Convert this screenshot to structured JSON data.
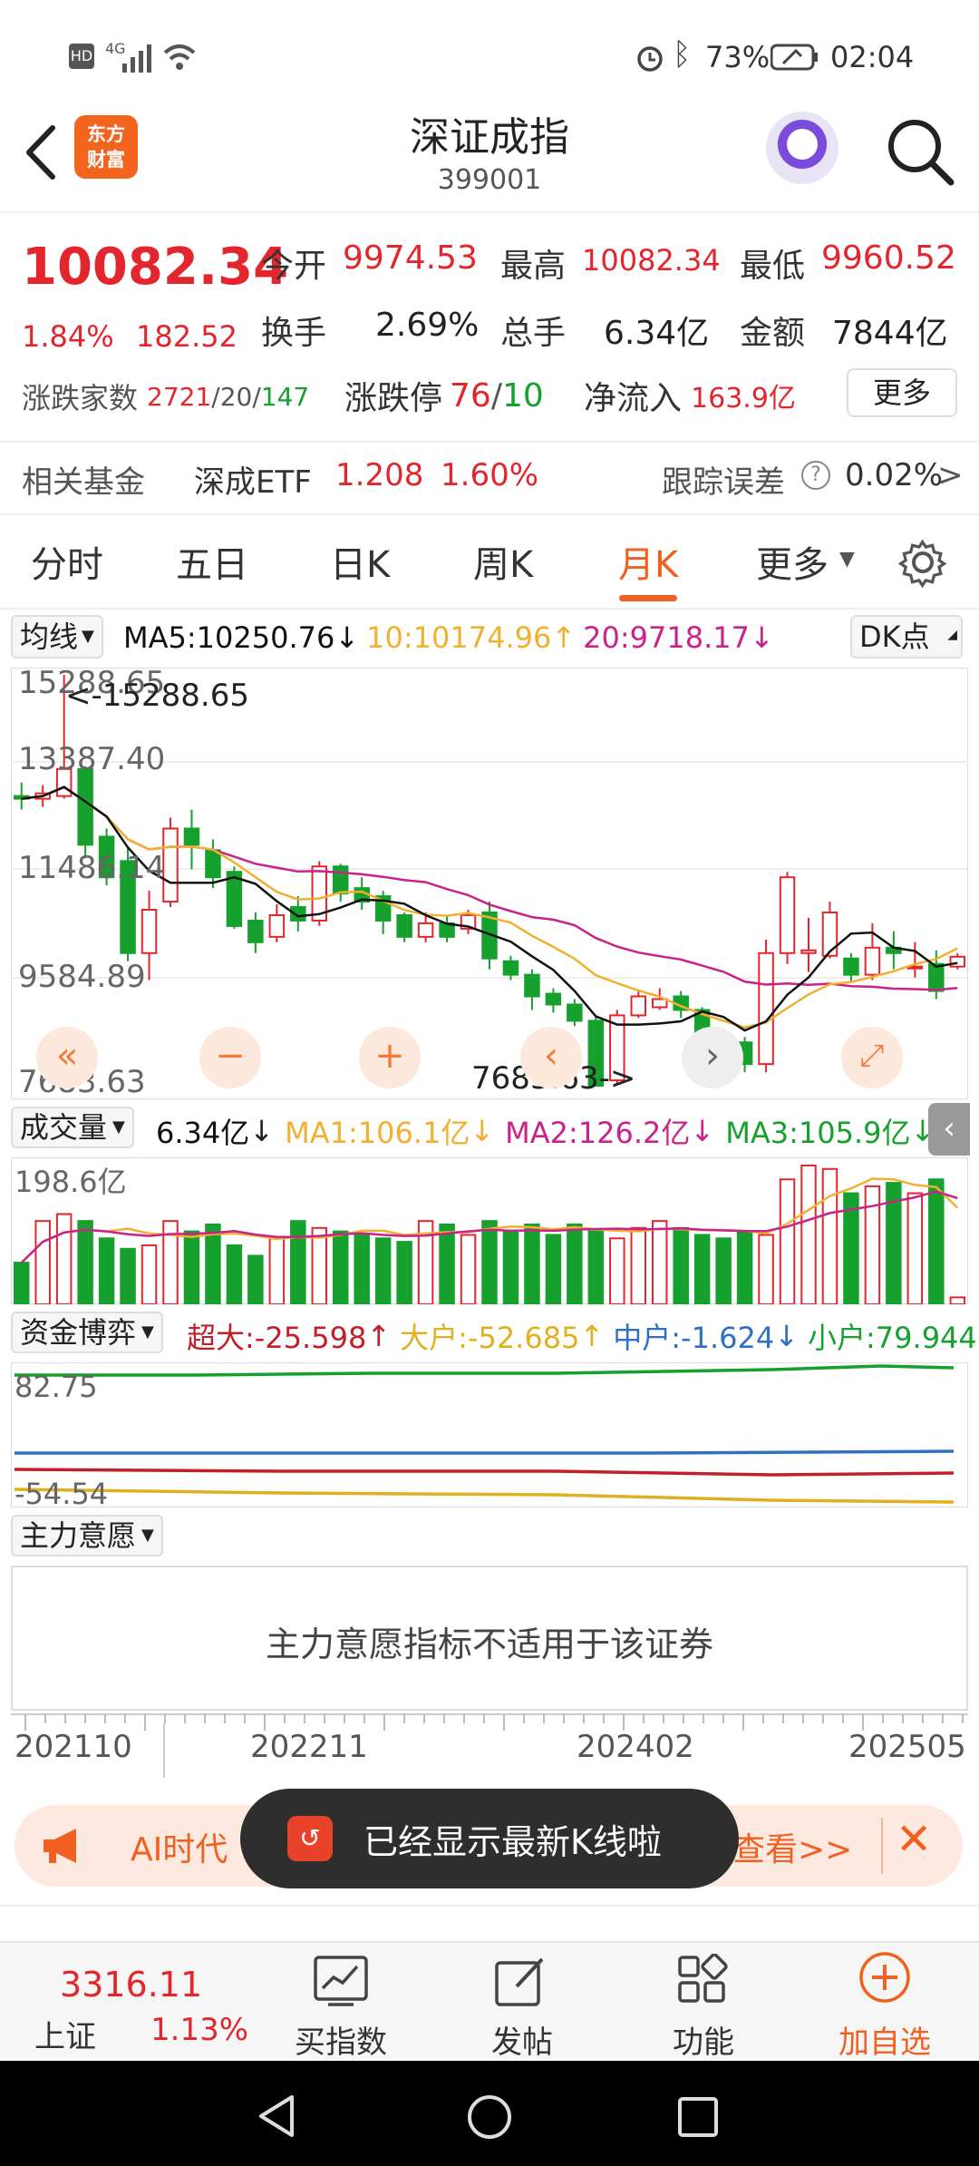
{
  "status_bar": {
    "left_icons": [
      "hd-icon",
      "signal-icon",
      "wifi-icon"
    ],
    "network_label": "4G",
    "battery": "73%",
    "time": "02:04"
  },
  "header": {
    "logo_line1": "东方",
    "logo_line2": "财富",
    "title": "深证成指",
    "code": "399001"
  },
  "quote": {
    "price": "10082.34",
    "change_pct": "1.84%",
    "change_abs": "182.52",
    "open_label": "今开",
    "open": "9974.53",
    "high_label": "最高",
    "high": "10082.34",
    "low_label": "最低",
    "low": "9960.52",
    "turnover_label": "换手",
    "turnover": "2.69%",
    "volume_label": "总手",
    "volume": "6.34亿",
    "amount_label": "金额",
    "amount": "7844亿",
    "updown_label": "涨跌家数",
    "up_count": "2721",
    "flat_count": "20",
    "down_count": "147",
    "limit_label": "涨跌停",
    "limit_up": "76",
    "limit_down": "10",
    "netflow_label": "净流入",
    "netflow": "163.9亿",
    "more_label": "更多"
  },
  "fund": {
    "label": "相关基金",
    "name": "深成ETF",
    "price": "1.208",
    "pct": "1.60%",
    "tracking_label": "跟踪误差",
    "tracking_value": "0.02%",
    "arrow": ">"
  },
  "tabs": [
    {
      "label": "分时"
    },
    {
      "label": "五日"
    },
    {
      "label": "日K"
    },
    {
      "label": "周K"
    },
    {
      "label": "月K"
    },
    {
      "label": "更多"
    }
  ],
  "active_tab": "月K",
  "ma": {
    "selector": "均线",
    "ma5": "MA5:10250.76",
    "ma10": "10:10174.96",
    "ma20": "20:9718.17",
    "dk_label": "DK点"
  },
  "price_axis": [
    "15288.65",
    "13387.40",
    "11486.14",
    "9584.89",
    "7683.63"
  ],
  "price_annotations": {
    "high": "<-15288.65",
    "low": "7683.63->"
  },
  "volume_row": {
    "selector": "成交量",
    "vol": "6.34亿",
    "ma1": "MA1:106.1亿",
    "ma2": "MA2:126.2亿",
    "ma3": "MA3:105.9亿",
    "axis_top": "198.6亿"
  },
  "fund_flow": {
    "selector": "资金博弈",
    "super": "超大:-25.598",
    "large": "大户:-52.685",
    "mid": "中户:-1.624",
    "small": "小户:79.944",
    "axis_top": "82.75",
    "axis_bottom": "-54.54"
  },
  "intent": {
    "selector": "主力意愿",
    "message": "主力意愿指标不适用于该证券"
  },
  "time_axis": [
    "202110",
    "202211",
    "202402",
    "202505"
  ],
  "banner": {
    "text": "AI时代",
    "link": "查看>>"
  },
  "toast": "已经显示最新K线啦",
  "bottom_bar": {
    "index_price": "3316.11",
    "index_name": "上证",
    "index_pct": "1.13%",
    "items": [
      "买指数",
      "发帖",
      "功能",
      "加自选"
    ]
  },
  "colors": {
    "up": "#e3262d",
    "down": "#16a02e",
    "accent": "#f06121",
    "ma5": "#111111",
    "ma10": "#f0b030",
    "ma20": "#c9228b"
  },
  "chart_data": {
    "type": "candlestick",
    "period": "monthly",
    "candles": [
      {
        "o": 13050,
        "c": 13000,
        "h": 13300,
        "l": 12800
      },
      {
        "o": 13000,
        "c": 13100,
        "h": 13250,
        "l": 12850
      },
      {
        "o": 13050,
        "c": 13550,
        "h": 15288.65,
        "l": 13000
      },
      {
        "o": 13550,
        "c": 12150,
        "h": 13600,
        "l": 11900
      },
      {
        "o": 12300,
        "c": 11550,
        "h": 12450,
        "l": 11400
      },
      {
        "o": 11850,
        "c": 10150,
        "h": 12100,
        "l": 10000
      },
      {
        "o": 10150,
        "c": 10950,
        "h": 11300,
        "l": 9650
      },
      {
        "o": 11100,
        "c": 12450,
        "h": 12650,
        "l": 11000
      },
      {
        "o": 12450,
        "c": 12150,
        "h": 12800,
        "l": 11700
      },
      {
        "o": 12050,
        "c": 11550,
        "h": 12250,
        "l": 11350
      },
      {
        "o": 11650,
        "c": 10650,
        "h": 11750,
        "l": 10600
      },
      {
        "o": 10750,
        "c": 10350,
        "h": 10900,
        "l": 10150
      },
      {
        "o": 10450,
        "c": 10850,
        "h": 11050,
        "l": 10350
      },
      {
        "o": 11000,
        "c": 10750,
        "h": 11200,
        "l": 10550
      },
      {
        "o": 10750,
        "c": 11750,
        "h": 11850,
        "l": 10650
      },
      {
        "o": 11750,
        "c": 11250,
        "h": 11800,
        "l": 11100
      },
      {
        "o": 11350,
        "c": 11100,
        "h": 11550,
        "l": 10950
      },
      {
        "o": 11200,
        "c": 10750,
        "h": 11300,
        "l": 10500
      },
      {
        "o": 10850,
        "c": 10450,
        "h": 10900,
        "l": 10350
      },
      {
        "o": 10450,
        "c": 10700,
        "h": 10900,
        "l": 10350
      },
      {
        "o": 10700,
        "c": 10450,
        "h": 10850,
        "l": 10350
      },
      {
        "o": 10600,
        "c": 10850,
        "h": 10950,
        "l": 10500
      },
      {
        "o": 10900,
        "c": 10050,
        "h": 11100,
        "l": 9850
      },
      {
        "o": 10000,
        "c": 9750,
        "h": 10100,
        "l": 9650
      },
      {
        "o": 9750,
        "c": 9350,
        "h": 9850,
        "l": 9100
      },
      {
        "o": 9400,
        "c": 9200,
        "h": 9500,
        "l": 9050
      },
      {
        "o": 9200,
        "c": 8900,
        "h": 9300,
        "l": 8800
      },
      {
        "o": 8900,
        "c": 7700,
        "h": 9000,
        "l": 7683.63
      },
      {
        "o": 7800,
        "c": 9000,
        "h": 9100,
        "l": 7750
      },
      {
        "o": 9000,
        "c": 9350,
        "h": 9450,
        "l": 8950
      },
      {
        "o": 9150,
        "c": 9300,
        "h": 9500,
        "l": 9100
      },
      {
        "o": 9350,
        "c": 9100,
        "h": 9450,
        "l": 8950
      },
      {
        "o": 9100,
        "c": 8600,
        "h": 9150,
        "l": 8500
      },
      {
        "o": 8650,
        "c": 8500,
        "h": 8750,
        "l": 8350
      },
      {
        "o": 8500,
        "c": 8100,
        "h": 8600,
        "l": 7950
      },
      {
        "o": 8100,
        "c": 10150,
        "h": 10400,
        "l": 7950
      },
      {
        "o": 10150,
        "c": 11550,
        "h": 11650,
        "l": 9950
      },
      {
        "o": 10150,
        "c": 10200,
        "h": 10800,
        "l": 9800
      },
      {
        "o": 10100,
        "c": 10900,
        "h": 11100,
        "l": 10050
      },
      {
        "o": 10050,
        "c": 9750,
        "h": 10150,
        "l": 9600
      },
      {
        "o": 9750,
        "c": 10250,
        "h": 10700,
        "l": 9650
      },
      {
        "o": 10250,
        "c": 10150,
        "h": 10550,
        "l": 9850
      },
      {
        "o": 9900,
        "c": 9900,
        "h": 10350,
        "l": 9700
      },
      {
        "o": 9950,
        "c": 9450,
        "h": 10200,
        "l": 9300
      },
      {
        "o": 9900,
        "c": 10082.34,
        "h": 10150,
        "l": 9850
      }
    ],
    "volume": [
      60,
      120,
      130,
      120,
      95,
      80,
      85,
      120,
      105,
      115,
      85,
      70,
      95,
      120,
      110,
      105,
      100,
      95,
      90,
      120,
      115,
      100,
      120,
      105,
      115,
      100,
      115,
      105,
      95,
      110,
      120,
      110,
      100,
      95,
      105,
      100,
      180,
      200,
      195,
      160,
      170,
      175,
      160,
      180,
      10
    ],
    "fund_flow_series": [
      {
        "name": "超大",
        "last": -25.598
      },
      {
        "name": "大户",
        "last": -52.685
      },
      {
        "name": "中户",
        "last": -1.624
      },
      {
        "name": "小户",
        "last": 79.944
      }
    ],
    "ylim": [
      7683.63,
      15288.65
    ],
    "volume_max": 198.6
  }
}
